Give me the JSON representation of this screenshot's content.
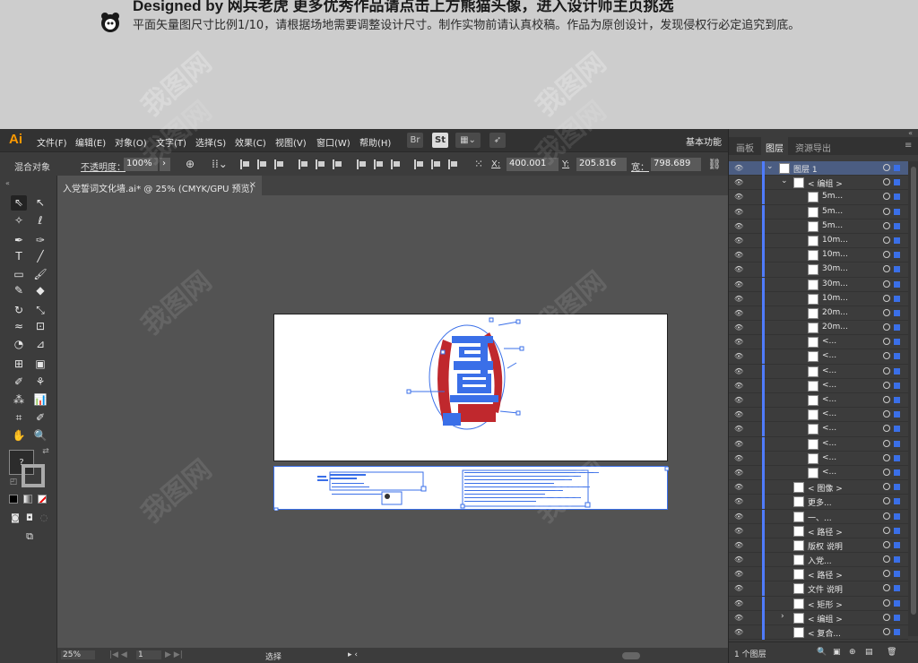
{
  "banner": {
    "headline": "Designed by 网兵老虎    更多优秀作品请点击上方熊猫头像，进入设计师主页挑选",
    "notice": "平面矢量图尺寸比例1/10，请根据场地需要调整设计尺寸。制作实物前请认真校稿。作品为原创设计，发现侵权行必定追究到底。"
  },
  "menubar": {
    "app_logo": "Ai",
    "items": [
      "文件(F)",
      "编辑(E)",
      "对象(O)",
      "文字(T)",
      "选择(S)",
      "效果(C)",
      "视图(V)",
      "窗口(W)",
      "帮助(H)"
    ],
    "st_label": "St",
    "workspace": "基本功能"
  },
  "control": {
    "object_type": "混合对象",
    "opacity_label": "不透明度：",
    "opacity_value": "100%",
    "x_label": "X:",
    "x_value": "400.001",
    "y_label": "Y:",
    "y_value": "205.816",
    "w_label": "宽：",
    "w_value": "798.689"
  },
  "document_tab": {
    "title": "入党誓词文化墙.ai* @ 25% (CMYK/GPU 预览)",
    "close": "×"
  },
  "status": {
    "zoom": "25%",
    "page": "1",
    "tool": "选择"
  },
  "panel": {
    "tabs": [
      "画板",
      "图层",
      "资源导出"
    ],
    "footer": "1 个图层",
    "layers": [
      {
        "name": "图层 1",
        "indent": 0,
        "twirl": "⌄",
        "selected": true
      },
      {
        "name": "< 编组 >",
        "indent": 1,
        "twirl": "⌄"
      },
      {
        "name": "5m...",
        "indent": 2
      },
      {
        "name": "5m...",
        "indent": 2
      },
      {
        "name": "5m...",
        "indent": 2
      },
      {
        "name": "10m...",
        "indent": 2
      },
      {
        "name": "10m...",
        "indent": 2
      },
      {
        "name": "30m...",
        "indent": 2
      },
      {
        "name": "30m...",
        "indent": 2
      },
      {
        "name": "10m...",
        "indent": 2
      },
      {
        "name": "20m...",
        "indent": 2
      },
      {
        "name": "20m...",
        "indent": 2
      },
      {
        "name": "<...",
        "indent": 2
      },
      {
        "name": "<...",
        "indent": 2
      },
      {
        "name": "<...",
        "indent": 2
      },
      {
        "name": "<...",
        "indent": 2
      },
      {
        "name": "<...",
        "indent": 2
      },
      {
        "name": "<...",
        "indent": 2
      },
      {
        "name": "<...",
        "indent": 2
      },
      {
        "name": "<...",
        "indent": 2
      },
      {
        "name": "<...",
        "indent": 2
      },
      {
        "name": "<...",
        "indent": 2
      },
      {
        "name": "< 图像 >",
        "indent": 1
      },
      {
        "name": "更多...",
        "indent": 1
      },
      {
        "name": "一、...",
        "indent": 1
      },
      {
        "name": "< 路径 >",
        "indent": 1
      },
      {
        "name": "版权 说明",
        "indent": 1
      },
      {
        "name": "入党...",
        "indent": 1
      },
      {
        "name": "< 路径 >",
        "indent": 1
      },
      {
        "name": "文件 说明",
        "indent": 1
      },
      {
        "name": "< 矩形 >",
        "indent": 1
      },
      {
        "name": "< 编组 >",
        "indent": 1,
        "twirl": "›"
      },
      {
        "name": "< 复合...",
        "indent": 1
      }
    ]
  },
  "watermark": "我图网",
  "colors": {
    "accent": "#3a6fe8",
    "logo_orange": "#ff9a00",
    "art_red": "#c0282d"
  }
}
